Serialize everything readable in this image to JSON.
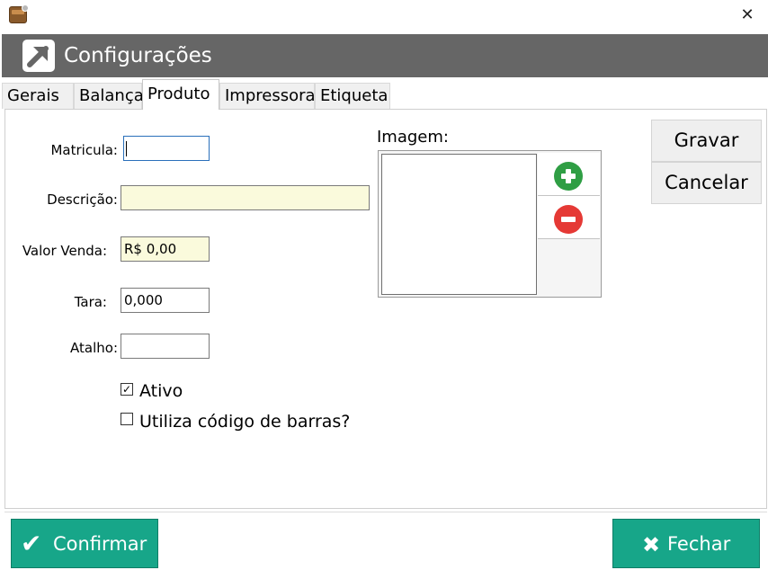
{
  "window": {
    "title": "Configurações",
    "close_glyph": "✕"
  },
  "tabs": [
    {
      "label": "Gerais"
    },
    {
      "label": "Balança"
    },
    {
      "label": "Produto"
    },
    {
      "label": "Impressora"
    },
    {
      "label": "Etiqueta"
    }
  ],
  "form": {
    "matricula_label": "Matricula:",
    "matricula_value": "",
    "descricao_label": "Descrição:",
    "descricao_value": "",
    "valor_venda_label": "Valor Venda:",
    "valor_venda_value": "R$ 0,00",
    "tara_label": "Tara:",
    "tara_value": "0,000",
    "atalho_label": "Atalho:",
    "atalho_value": "",
    "ativo_label": "Ativo",
    "ativo_checked": true,
    "ativo_mark": "✓",
    "barcode_label": "Utiliza código de barras?",
    "barcode_checked": false
  },
  "image": {
    "label": "Imagem:"
  },
  "side_buttons": {
    "save": "Gravar",
    "cancel": "Cancelar"
  },
  "footer": {
    "confirm": "Confirmar",
    "confirm_icon": "✔",
    "close": "Fechar",
    "close_icon": "✖"
  },
  "colors": {
    "header_bg": "#666666",
    "accent_green": "#17a689",
    "yellow_field": "#fafadc"
  }
}
